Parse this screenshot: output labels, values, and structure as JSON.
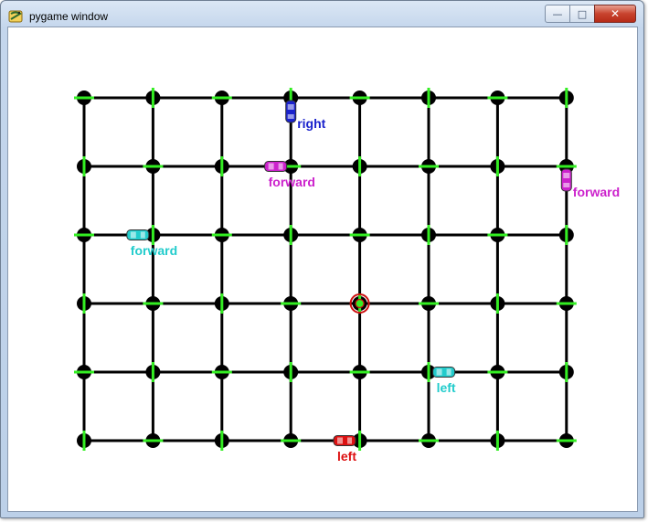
{
  "window": {
    "title": "pygame window",
    "icon": "pygame-snake-icon",
    "controls": {
      "minimize": "minimize-icon",
      "maximize": "maximize-icon",
      "close": "close-icon"
    }
  },
  "grid": {
    "columns": 8,
    "rows": 6,
    "line_color": "#000000",
    "node_color": "#000000",
    "marker_color": "#33ee22"
  },
  "target": {
    "col": 4,
    "row": 3,
    "ring_color": "#cc1111",
    "dot_color": "#33ee22"
  },
  "cars": [
    {
      "id": "car-blue-right",
      "color": "#1a22cc",
      "label": "right",
      "label_color": "#1a22cc",
      "col": 3,
      "row": 0,
      "heading": "vertical",
      "offset": 0.2
    },
    {
      "id": "car-magenta-center-forward",
      "color": "#cc22cc",
      "label": "forward",
      "label_color": "#cc22cc",
      "col": 3,
      "row": 1,
      "heading": "horizontal",
      "offset": -0.22
    },
    {
      "id": "car-magenta-right-forward",
      "color": "#cc22cc",
      "label": "forward",
      "label_color": "#cc22cc",
      "col": 7,
      "row": 1,
      "heading": "vertical",
      "offset": 0.2
    },
    {
      "id": "car-cyan-left-forward",
      "color": "#22cccc",
      "label": "forward",
      "label_color": "#22cccc",
      "col": 1,
      "row": 2,
      "heading": "horizontal",
      "offset": -0.22
    },
    {
      "id": "car-cyan-left",
      "color": "#22cccc",
      "label": "left",
      "label_color": "#22cccc",
      "col": 5,
      "row": 4,
      "heading": "horizontal",
      "offset": 0.22
    },
    {
      "id": "car-red-left",
      "color": "#dd1111",
      "label": "left",
      "label_color": "#dd1111",
      "col": 4,
      "row": 5,
      "heading": "horizontal",
      "offset": -0.22
    }
  ]
}
